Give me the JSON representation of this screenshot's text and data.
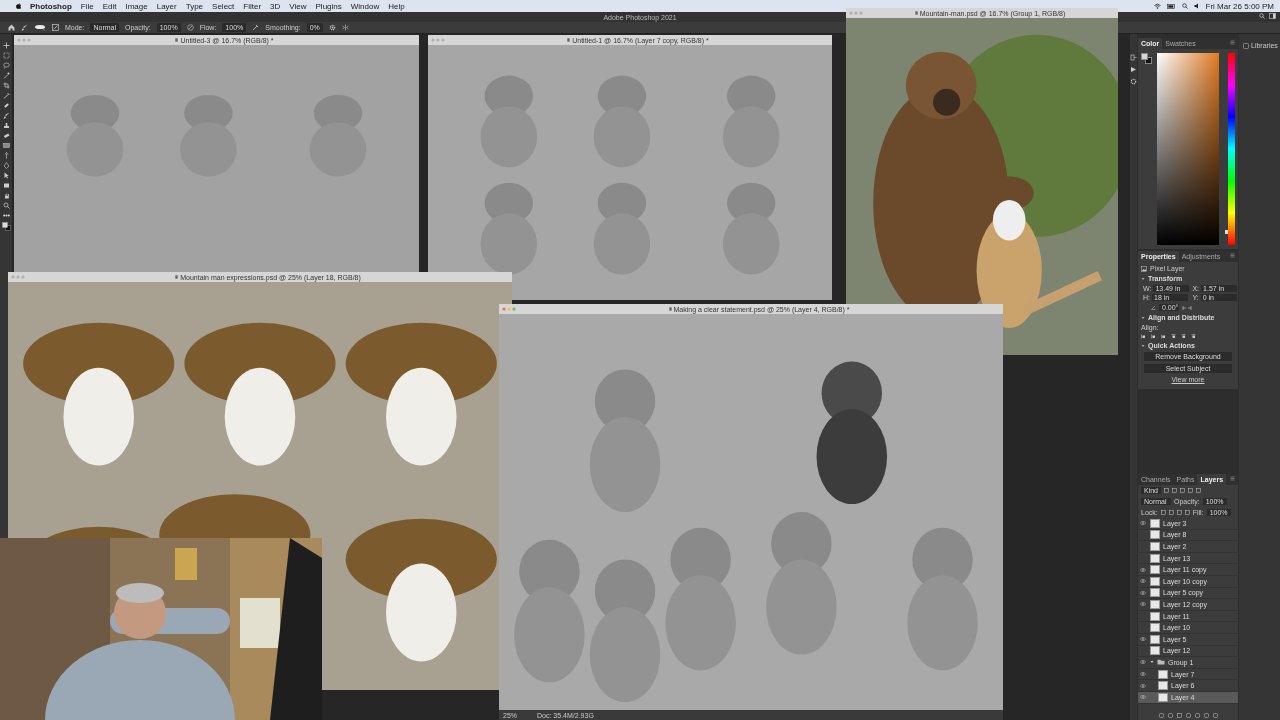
{
  "menu_bar": {
    "app": "Photoshop",
    "items": [
      "File",
      "Edit",
      "Image",
      "Layer",
      "Type",
      "Select",
      "Filter",
      "3D",
      "View",
      "Plugins",
      "Window",
      "Help"
    ],
    "clock": "Fri Mar 26 5:00 PM"
  },
  "app_title": "Adobe Photoshop 2021",
  "options_bar": [
    {
      "label": "Mode:",
      "value": "Normal"
    },
    {
      "label": "Opacity:",
      "value": "100%"
    },
    {
      "label": "Flow:",
      "value": "100%"
    },
    {
      "label": "Smoothing:",
      "value": "0%"
    }
  ],
  "documents": [
    {
      "title": "Untitled-3 @ 16.7% (RGB/8) *",
      "active": false
    },
    {
      "title": "Untitled-1 @ 16.7% (Layer 7 copy, RGB/8) *",
      "active": false
    },
    {
      "title": "Mountain-man.psd @ 16.7% (Group 1, RGB/8)",
      "active": false
    },
    {
      "title": "Mountain man expressions.psd @ 25% (Layer 18, RGB/8)",
      "active": false
    },
    {
      "title": "Making a clear statement.psd @ 25% (Layer 4, RGB/8) *",
      "active": true,
      "status_bar": {
        "zoom": "25%",
        "doc": "Doc: 35.4M/2.93G"
      }
    }
  ],
  "color_panel": {
    "tabs": [
      {
        "label": "Color",
        "selected": true
      },
      {
        "label": "Swatches",
        "selected": false
      }
    ],
    "hue_slider": {
      "level": 0.07
    }
  },
  "libraries": {
    "label": "Libraries"
  },
  "properties": {
    "tabs": [
      {
        "label": "Properties",
        "selected": true
      },
      {
        "label": "Adjustments",
        "selected": false
      }
    ],
    "layer_type": "Pixel Layer",
    "transform_title": "Transform",
    "fields": [
      {
        "label": "W:",
        "value": "13.49 in"
      },
      {
        "label": "X:",
        "value": "1.57 in"
      },
      {
        "label": "H:",
        "value": "18 in"
      },
      {
        "label": "Y:",
        "value": "0 in"
      }
    ],
    "angle": "0.00°",
    "align_title": "Align and Distribute",
    "align_label": "Align:",
    "quick_title": "Quick Actions",
    "actions": [
      "Remove Background",
      "Select Subject"
    ],
    "more_link": "View more"
  },
  "layers_panel": {
    "tabs": [
      {
        "label": "Channels",
        "selected": false
      },
      {
        "label": "Paths",
        "selected": false
      },
      {
        "label": "Layers",
        "selected": true
      }
    ],
    "filter": "Kind",
    "blend": "Normal",
    "opacity_label": "Opacity:",
    "opacity": "100%",
    "lock_label": "Lock:",
    "fill_label": "Fill:",
    "fill": "100%",
    "layers": [
      {
        "name": "Layer 3",
        "visible": true,
        "selected": false
      },
      {
        "name": "Layer 8",
        "visible": false,
        "selected": false
      },
      {
        "name": "Layer 2",
        "visible": false,
        "selected": false
      },
      {
        "name": "Layer 13",
        "visible": false,
        "selected": false
      },
      {
        "name": "Layer 11 copy",
        "visible": true,
        "selected": false
      },
      {
        "name": "Layer 10 copy",
        "visible": true,
        "selected": false
      },
      {
        "name": "Layer 5 copy",
        "visible": true,
        "selected": false
      },
      {
        "name": "Layer 12 copy",
        "visible": true,
        "selected": false
      },
      {
        "name": "Layer 11",
        "visible": false,
        "selected": false
      },
      {
        "name": "Layer 10",
        "visible": false,
        "selected": false
      },
      {
        "name": "Layer 5",
        "visible": true,
        "selected": false
      },
      {
        "name": "Layer 12",
        "visible": false,
        "selected": false
      },
      {
        "name": "Group 1",
        "visible": true,
        "selected": false,
        "expanded": true,
        "children": [
          {
            "name": "Layer 7",
            "visible": true,
            "selected": false
          },
          {
            "name": "Layer 6",
            "visible": true,
            "selected": false
          },
          {
            "name": "Layer 4",
            "visible": true,
            "selected": true
          }
        ]
      }
    ]
  }
}
